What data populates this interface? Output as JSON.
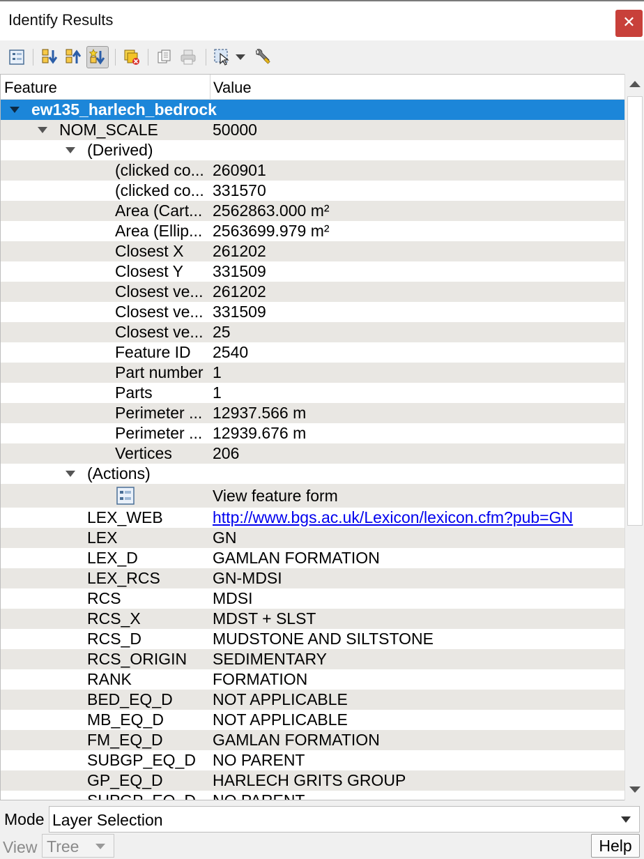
{
  "window": {
    "title": "Identify Results",
    "close_glyph": "✕"
  },
  "toolbar": {
    "buttons": [
      {
        "name": "view-feature-form-icon"
      },
      {
        "name": "expand-tree-icon"
      },
      {
        "name": "collapse-tree-icon"
      },
      {
        "name": "expand-new-results-icon"
      },
      {
        "name": "clear-results-icon"
      },
      {
        "name": "copy-feature-icon"
      },
      {
        "name": "print-icon"
      },
      {
        "name": "select-features-icon"
      },
      {
        "name": "dropdown-arrow-icon"
      },
      {
        "name": "settings-wrench-icon"
      }
    ]
  },
  "tree": {
    "columns": {
      "feature": "Feature",
      "value": "Value"
    },
    "layer": "ew135_harlech_bedrock",
    "rows": [
      {
        "feature": "NOM_SCALE",
        "value": "50000"
      },
      {
        "feature": "(Derived)",
        "value": ""
      },
      {
        "feature": "(clicked co...",
        "value": "260901"
      },
      {
        "feature": "(clicked co...",
        "value": "331570"
      },
      {
        "feature": "Area (Cart...",
        "value": "2562863.000 m²"
      },
      {
        "feature": "Area (Ellip...",
        "value": "2563699.979 m²"
      },
      {
        "feature": "Closest X",
        "value": "261202"
      },
      {
        "feature": "Closest Y",
        "value": "331509"
      },
      {
        "feature": "Closest ve...",
        "value": "261202"
      },
      {
        "feature": "Closest ve...",
        "value": "331509"
      },
      {
        "feature": "Closest ve...",
        "value": "25"
      },
      {
        "feature": "Feature ID",
        "value": "2540"
      },
      {
        "feature": "Part number",
        "value": "1"
      },
      {
        "feature": "Parts",
        "value": "1"
      },
      {
        "feature": "Perimeter ...",
        "value": "12937.566 m"
      },
      {
        "feature": "Perimeter ...",
        "value": "12939.676 m"
      },
      {
        "feature": "Vertices",
        "value": "206"
      },
      {
        "feature": "(Actions)",
        "value": ""
      },
      {
        "feature": "",
        "value": "View feature form"
      },
      {
        "feature": "LEX_WEB",
        "value": "http://www.bgs.ac.uk/Lexicon/lexicon.cfm?pub=GN"
      },
      {
        "feature": "LEX",
        "value": "GN"
      },
      {
        "feature": "LEX_D",
        "value": "GAMLAN FORMATION"
      },
      {
        "feature": "LEX_RCS",
        "value": "GN-MDSI"
      },
      {
        "feature": "RCS",
        "value": "MDSI"
      },
      {
        "feature": "RCS_X",
        "value": "MDST + SLST"
      },
      {
        "feature": "RCS_D",
        "value": "MUDSTONE AND SILTSTONE"
      },
      {
        "feature": "RCS_ORIGIN",
        "value": "SEDIMENTARY"
      },
      {
        "feature": "RANK",
        "value": "FORMATION"
      },
      {
        "feature": "BED_EQ_D",
        "value": "NOT APPLICABLE"
      },
      {
        "feature": "MB_EQ_D",
        "value": "NOT APPLICABLE"
      },
      {
        "feature": "FM_EQ_D",
        "value": "GAMLAN FORMATION"
      },
      {
        "feature": "SUBGP_EQ_D",
        "value": "NO PARENT"
      },
      {
        "feature": "GP_EQ_D",
        "value": "HARLECH GRITS GROUP"
      },
      {
        "feature": "SUPGP_EQ_D",
        "value": "NO PARENT"
      }
    ]
  },
  "footer": {
    "mode_label": "Mode",
    "mode_value": "Layer Selection",
    "view_label": "View",
    "view_value": "Tree",
    "help_label": "Help"
  },
  "colors": {
    "selection": "#1c86d9",
    "alt_row": "#e9e7e3",
    "close_button": "#c8403a",
    "link": "#0000ee"
  }
}
